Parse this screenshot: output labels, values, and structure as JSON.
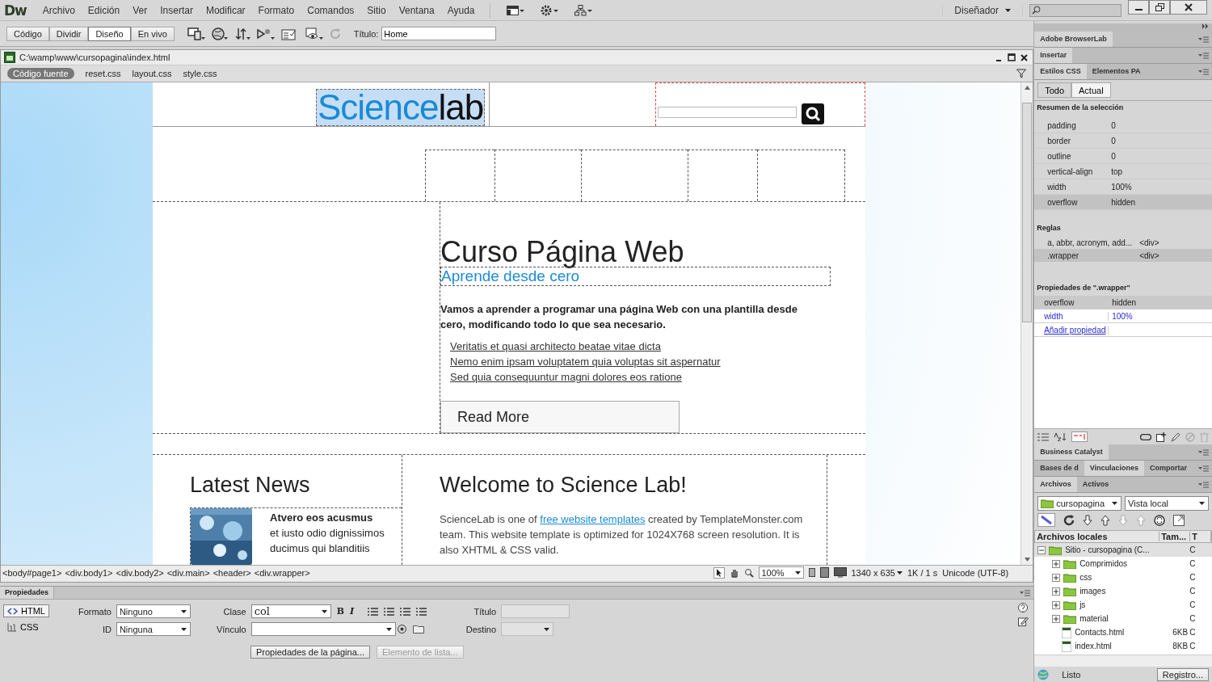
{
  "app": {
    "logo": "Dw",
    "menu": [
      "Archivo",
      "Edición",
      "Ver",
      "Insertar",
      "Modificar",
      "Formato",
      "Comandos",
      "Sitio",
      "Ventana",
      "Ayuda"
    ],
    "workspace": "Diseñador"
  },
  "toolbar": {
    "views": [
      {
        "label": "Código",
        "selected": false
      },
      {
        "label": "Dividir",
        "selected": false
      },
      {
        "label": "Diseño",
        "selected": true
      },
      {
        "label": "En vivo",
        "selected": false
      }
    ],
    "title_label": "Título:",
    "title_value": "Home"
  },
  "document": {
    "path": "C:\\wamp\\www\\cursopagina\\index.html",
    "related_files": [
      {
        "label": "Código fuente",
        "selected": true
      },
      {
        "label": "reset.css",
        "selected": false
      },
      {
        "label": "layout.css",
        "selected": false
      },
      {
        "label": "style.css",
        "selected": false
      }
    ]
  },
  "page": {
    "logo_first": "Science",
    "logo_second": "lab",
    "heading": "Curso Página Web",
    "subheading": "Aprende desde cero",
    "intro": "Vamos a aprender a programar una página Web con una plantilla desde cero, modificando todo lo que sea necesario.",
    "links": [
      "Veritatis et quasi architecto beatae vitae dicta",
      "Nemo enim ipsam voluptatem quia voluptas sit aspernatur",
      "Sed quia consequuntur magni dolores eos ratione"
    ],
    "button": "Read More",
    "news_title": "Latest News",
    "news_item_title": "Atvero eos acusmus",
    "news_item_text": "et iusto odio dignissimos ducimus qui blanditiis",
    "welcome_title": "Welcome to Science Lab!",
    "welcome_before": "ScienceLab is one of",
    "welcome_link": "free website templates",
    "welcome_after": "created by TemplateMonster.com team. This website template is optimized for 1024X768 screen resolution. It is also XHTML & CSS valid."
  },
  "tag_selector": [
    "<body#page1>",
    "<div.body1>",
    "<div.body2>",
    "<div.main>",
    "<header>",
    "<div.wrapper>"
  ],
  "status": {
    "zoom": "100%",
    "window_size": "1340 x 635",
    "download": "1K / 1 s",
    "encoding": "Unicode (UTF-8)"
  },
  "properties": {
    "title": "Propiedades",
    "modes": [
      {
        "label": "HTML",
        "selected": true
      },
      {
        "label": "CSS",
        "selected": false
      }
    ],
    "format_label": "Formato",
    "format_value": "Ninguno",
    "id_label": "ID",
    "id_value": "Ninguna",
    "class_label": "Clase",
    "class_value": "col",
    "bold": "B",
    "italic": "I",
    "link_label": "Vínculo",
    "title_label": "Título",
    "target_label": "Destino",
    "buttons": [
      {
        "label": "Propiedades de la página...",
        "disabled": false
      },
      {
        "label": "Elemento de lista...",
        "disabled": true
      }
    ]
  },
  "panels": {
    "browserlab": "Adobe BrowserLab",
    "insert": "Insertar",
    "css_tabs": [
      {
        "label": "Estilos CSS",
        "selected": true
      },
      {
        "label": "Elementos PA",
        "selected": false
      }
    ],
    "css_modes": [
      {
        "label": "Todo",
        "selected": false
      },
      {
        "label": "Actual",
        "selected": true
      }
    ],
    "summary_title": "Resumen de la selección",
    "summary": [
      {
        "name": "padding",
        "value": "0",
        "selected": false
      },
      {
        "name": "border",
        "value": "0",
        "selected": false
      },
      {
        "name": "outline",
        "value": "0",
        "selected": false
      },
      {
        "name": "vertical-align",
        "value": "top",
        "selected": false
      },
      {
        "name": "width",
        "value": "100%",
        "selected": false
      },
      {
        "name": "overflow",
        "value": "hidden",
        "selected": true
      }
    ],
    "rules_title": "Reglas",
    "rules": [
      {
        "name": "a, abbr, acronym, add...",
        "tag": "<div>",
        "selected": false
      },
      {
        "name": ".wrapper",
        "tag": "<div>",
        "selected": true
      }
    ],
    "props_title": "Propiedades de \".wrapper\"",
    "props": [
      {
        "name": "overflow",
        "value": "hidden",
        "selected": true,
        "highlighted": false
      },
      {
        "name": "width",
        "value": "100%",
        "selected": false,
        "highlighted": true
      }
    ],
    "add_property": "Añadir propiedad",
    "business": "Business Catalyst",
    "data_tabs": [
      {
        "label": "Bases de d",
        "selected": false
      },
      {
        "label": "Vinculaciones",
        "selected": true
      },
      {
        "label": "Comportar",
        "selected": false
      }
    ],
    "file_tabs": [
      {
        "label": "Archivos",
        "selected": true
      },
      {
        "label": "Activos",
        "selected": false
      }
    ],
    "site": "cursopagina",
    "view": "Vista local",
    "columns": [
      "Archivos locales",
      "Tam...",
      "T"
    ],
    "tree": [
      {
        "kind": "site",
        "name": "Sitio - cursopagina (C...",
        "type": "C",
        "expanded": true,
        "children": [
          {
            "kind": "folder",
            "name": "Comprimidos",
            "type": "C",
            "expanded": false
          },
          {
            "kind": "folder",
            "name": "css",
            "type": "C",
            "expanded": false
          },
          {
            "kind": "folder",
            "name": "images",
            "type": "C",
            "expanded": false
          },
          {
            "kind": "folder",
            "name": "js",
            "type": "C",
            "expanded": false
          },
          {
            "kind": "folder",
            "name": "material",
            "type": "C",
            "expanded": false
          },
          {
            "kind": "file",
            "name": "Contacts.html",
            "size": "6KB",
            "type": "C"
          },
          {
            "kind": "file",
            "name": "index.html",
            "size": "8KB",
            "type": "C"
          }
        ]
      }
    ],
    "status": "Listo",
    "log_button": "Registro..."
  }
}
